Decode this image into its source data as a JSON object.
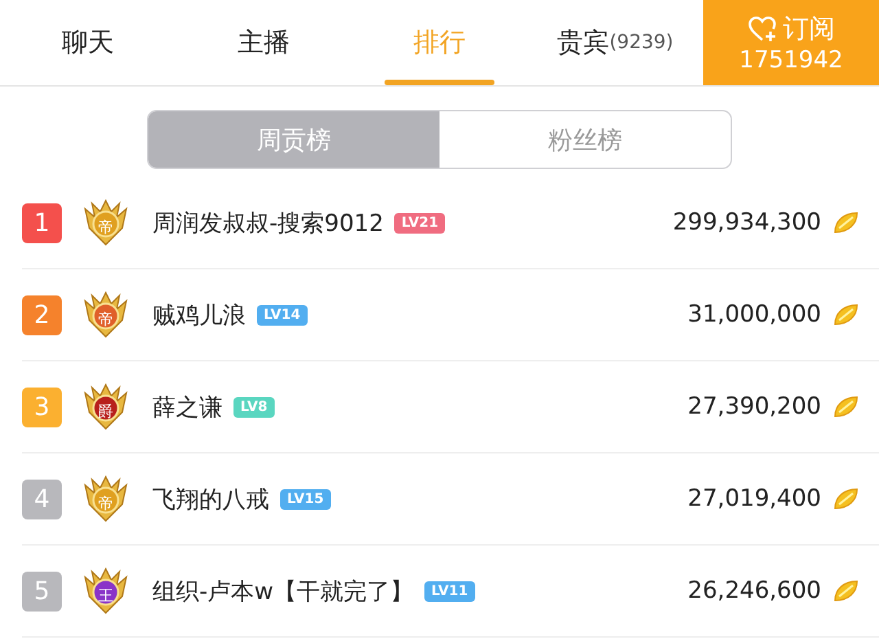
{
  "tabs": [
    {
      "label": "聊天",
      "selected": false
    },
    {
      "label": "主播",
      "selected": false
    },
    {
      "label": "排行",
      "selected": true
    },
    {
      "label": "贵宾",
      "count": "(9239)",
      "selected": false
    }
  ],
  "subscribe": {
    "label": "订阅",
    "count": "1751942"
  },
  "segments": [
    {
      "label": "周贡榜",
      "selected": true
    },
    {
      "label": "粉丝榜",
      "selected": false
    }
  ],
  "rows": [
    {
      "rank": "1",
      "color": "#f4504c",
      "medal": {
        "label": "帝",
        "color": "#e0a020"
      },
      "name": "周润发叔叔-搜索9012",
      "level_tag": {
        "label": "LV21",
        "color": "#f06c80"
      },
      "amount": "299,934,300"
    },
    {
      "rank": "2",
      "color": "#f5822c",
      "medal": {
        "label": "帝",
        "color": "#e0602a"
      },
      "name": "贼鸡儿浪",
      "level_tag": {
        "label": "LV14",
        "color": "#52aef0"
      },
      "amount": "31,000,000"
    },
    {
      "rank": "3",
      "color": "#fbb030",
      "medal": {
        "label": "爵",
        "color": "#b8201c"
      },
      "name": "薛之谦",
      "level_tag": {
        "label": "LV8",
        "color": "#5ad6c0"
      },
      "amount": "27,390,200"
    },
    {
      "rank": "4",
      "color": "#b8b8bc",
      "medal": {
        "label": "帝",
        "color": "#e0a020"
      },
      "name": "飞翔的八戒",
      "level_tag": {
        "label": "LV15",
        "color": "#52aef0"
      },
      "amount": "27,019,400"
    },
    {
      "rank": "5",
      "color": "#b8b8bc",
      "medal": {
        "label": "王",
        "color": "#8a34c8"
      },
      "name": "组织-卢本w【干就完了】",
      "level_tag": {
        "label": "LV11",
        "color": "#52aef0"
      },
      "amount": "26,246,600"
    }
  ]
}
